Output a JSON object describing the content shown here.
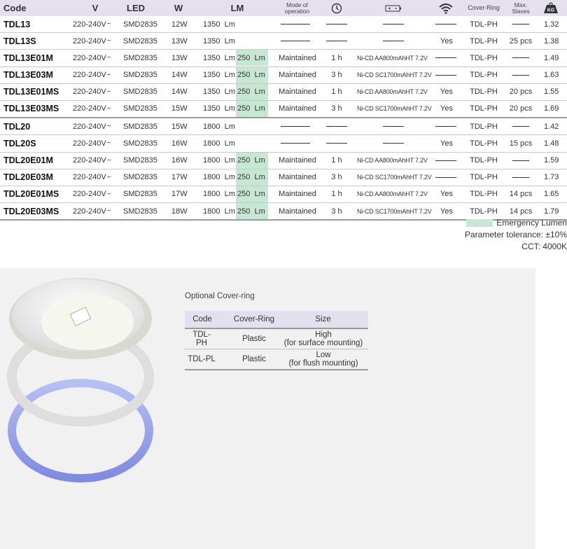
{
  "headers": {
    "code": "Code",
    "v": "V",
    "led": "LED",
    "w": "W",
    "lm": "LM",
    "mode": "Mode of operation",
    "time": "clock-icon",
    "battery": "battery-icon",
    "wifi": "wifi-icon",
    "cover": "Cover-Ring",
    "slaves": "Max. Slaves",
    "kg": "KG"
  },
  "rows": [
    {
      "code": "TDL13",
      "v": "220-240V",
      "led": "SMD2835",
      "w": "12W",
      "lm": "1350",
      "em": "",
      "mode": "",
      "time": "",
      "bat": "",
      "wifi": "",
      "cover": "TDL-PH",
      "slaves": "",
      "kg": "1.32"
    },
    {
      "code": "TDL13S",
      "v": "220-240V",
      "led": "SMD2835",
      "w": "13W",
      "lm": "1350",
      "em": "",
      "mode": "",
      "time": "",
      "bat": "",
      "wifi": "Yes",
      "cover": "TDL-PH",
      "slaves": "25 pcs",
      "kg": "1.38"
    },
    {
      "code": "TDL13E01M",
      "v": "220-240V",
      "led": "SMD2835",
      "w": "13W",
      "lm": "1350",
      "em": "250",
      "mode": "Maintained",
      "time": "1 h",
      "bat": "Ni-CD AA800mAhHT 7.2V",
      "wifi": "",
      "cover": "TDL-PH",
      "slaves": "",
      "kg": "1.49"
    },
    {
      "code": "TDL13E03M",
      "v": "220-240V",
      "led": "SMD2835",
      "w": "14W",
      "lm": "1350",
      "em": "250",
      "mode": "Maintained",
      "time": "3 h",
      "bat": "Ni-CD SC1700mAhHT 7.2V",
      "wifi": "",
      "cover": "TDL-PH",
      "slaves": "",
      "kg": "1.63"
    },
    {
      "code": "TDL13E01MS",
      "v": "220-240V",
      "led": "SMD2835",
      "w": "14W",
      "lm": "1350",
      "em": "250",
      "mode": "Maintained",
      "time": "1 h",
      "bat": "Ni-CD AA800mAhHT 7.2V",
      "wifi": "Yes",
      "cover": "TDL-PH",
      "slaves": "20 pcs",
      "kg": "1.55"
    },
    {
      "code": "TDL13E03MS",
      "v": "220-240V",
      "led": "SMD2835",
      "w": "15W",
      "lm": "1350",
      "em": "250",
      "mode": "Maintained",
      "time": "3 h",
      "bat": "Ni-CD SC1700mAhHT 7.2V",
      "wifi": "Yes",
      "cover": "TDL-PH",
      "slaves": "20 pcs",
      "kg": "1.69"
    },
    {
      "code": "TDL20",
      "v": "220-240V",
      "led": "SMD2835",
      "w": "15W",
      "lm": "1800",
      "em": "",
      "mode": "",
      "time": "",
      "bat": "",
      "wifi": "",
      "cover": "TDL-PH",
      "slaves": "",
      "kg": "1.42"
    },
    {
      "code": "TDL20S",
      "v": "220-240V",
      "led": "SMD2835",
      "w": "16W",
      "lm": "1800",
      "em": "",
      "mode": "",
      "time": "",
      "bat": "",
      "wifi": "Yes",
      "cover": "TDL-PH",
      "slaves": "15 pcs",
      "kg": "1.48"
    },
    {
      "code": "TDL20E01M",
      "v": "220-240V",
      "led": "SMD2835",
      "w": "16W",
      "lm": "1800",
      "em": "250",
      "mode": "Maintained",
      "time": "1 h",
      "bat": "Ni-CD AA800mAhHT 7.2V",
      "wifi": "",
      "cover": "TDL-PH",
      "slaves": "",
      "kg": "1.59"
    },
    {
      "code": "TDL20E03M",
      "v": "220-240V",
      "led": "SMD2835",
      "w": "17W",
      "lm": "1800",
      "em": "250",
      "mode": "Maintained",
      "time": "3 h",
      "bat": "Ni-CD SC1700mAhHT 7.2V",
      "wifi": "",
      "cover": "TDL-PH",
      "slaves": "",
      "kg": "1.73"
    },
    {
      "code": "TDL20E01MS",
      "v": "220-240V",
      "led": "SMD2835",
      "w": "17W",
      "lm": "1800",
      "em": "250",
      "mode": "Maintained",
      "time": "1 h",
      "bat": "Ni-CD AA800mAhHT 7.2V",
      "wifi": "Yes",
      "cover": "TDL-PH",
      "slaves": "14 pcs",
      "kg": "1.65"
    },
    {
      "code": "TDL20E03MS",
      "v": "220-240V",
      "led": "SMD2835",
      "w": "18W",
      "lm": "1800",
      "em": "250",
      "mode": "Maintained",
      "time": "3 h",
      "bat": "Ni-CD SC1700mAhHT 7.2V",
      "wifi": "Yes",
      "cover": "TDL-PH",
      "slaves": "14 pcs",
      "kg": "1.79"
    }
  ],
  "units": {
    "lm": "Lm",
    "tilde": "~"
  },
  "legend": {
    "emergency": "Emergency  Lumen",
    "tolerance": "Parameter tolerance: ±10%",
    "cct": "CCT: 4000K"
  },
  "colors": {
    "header_bg": "#e4e0ed",
    "emergency_bg": "#c8e7d2",
    "panel_bg": "#f1f1f1",
    "ring_blue": "#8f9be6"
  },
  "optional": {
    "title": "Optional  Cover-ring",
    "headers": {
      "code": "Code",
      "cover": "Cover-Ring",
      "size": "Size"
    },
    "rows": [
      {
        "code": "TDL-PH",
        "cover": "Plastic",
        "size_main": "High",
        "size_sub": "(for surface mounting)"
      },
      {
        "code": "TDL-PL",
        "cover": "Plastic",
        "size_main": "Low",
        "size_sub": "(for flush mounting)"
      }
    ]
  }
}
